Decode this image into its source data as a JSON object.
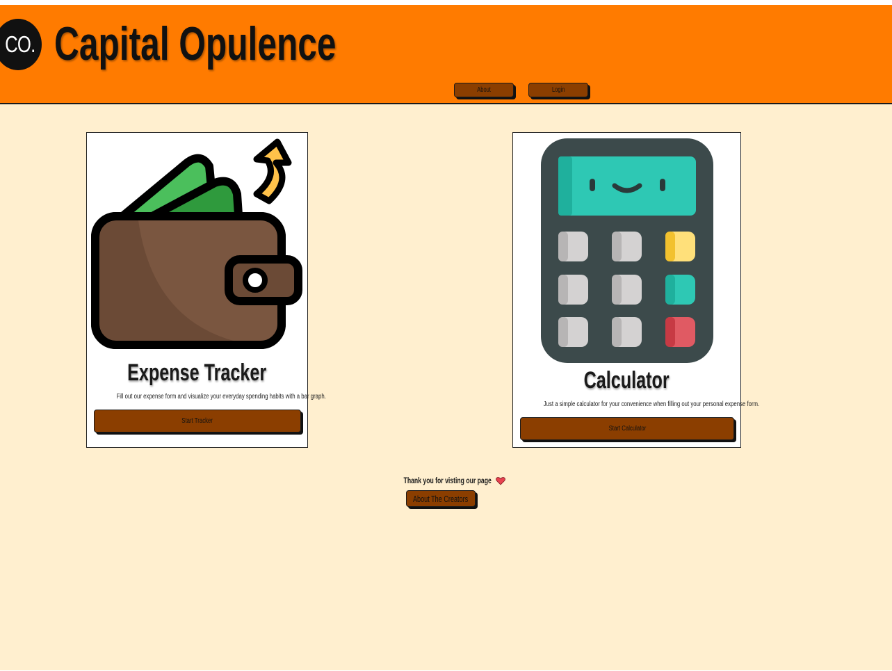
{
  "header": {
    "logo_text": "CO.",
    "brand": "Capital Opulence",
    "nav": [
      {
        "label": "About"
      },
      {
        "label": "Login"
      }
    ]
  },
  "cards": [
    {
      "title": "Expense Tracker",
      "description": "Fill out our expense form and visualize your everyday spending habits with a bar graph.",
      "button": "Start Tracker",
      "image": "wallet-icon"
    },
    {
      "title": "Calculator",
      "description": "Just a simple calculator for your convenience when filling out your personal expense form.",
      "button": "Start Calculator",
      "image": "calculator-icon"
    }
  ],
  "footer": {
    "thanks": "Thank you for visting our page",
    "button": "About The Creators"
  },
  "colors": {
    "header_bg": "#ff7b00",
    "page_bg": "#ffefcf",
    "button_bg": "#8b3e00"
  }
}
